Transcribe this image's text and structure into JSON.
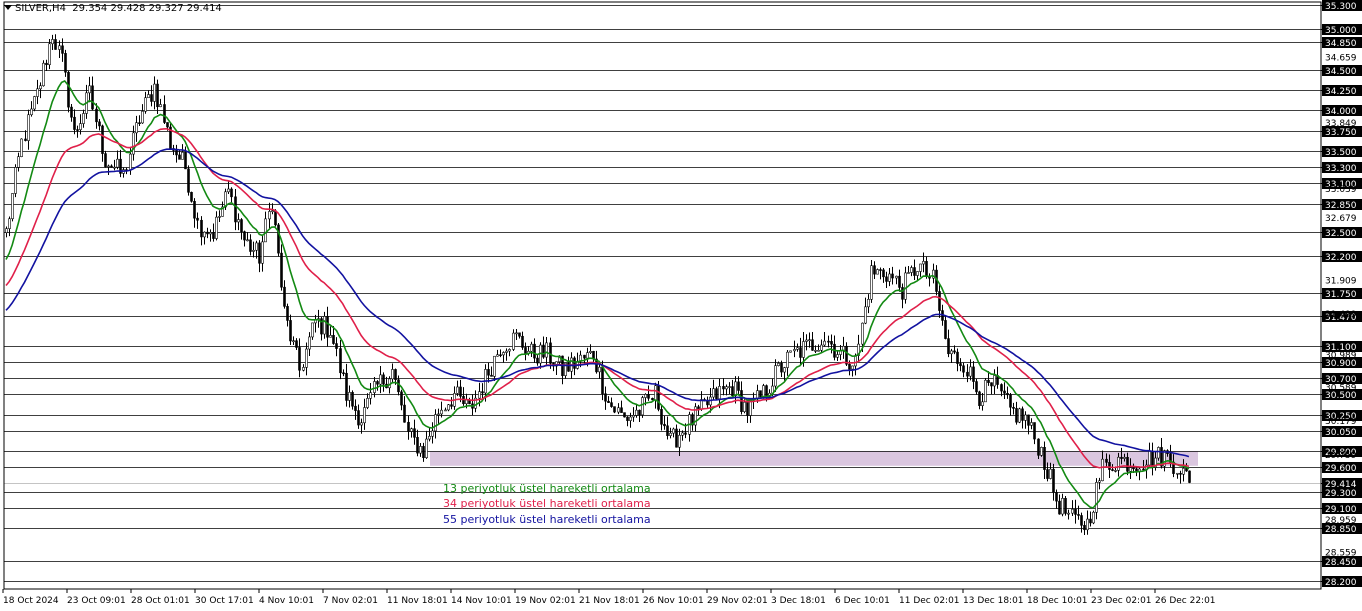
{
  "header": {
    "symbol": "SILVER,H4",
    "ohlc": "29.354 29.428 29.327 29.414"
  },
  "legend": [
    {
      "label": "13 periyotluk üstel hareketli ortalama",
      "color": "#138a13"
    },
    {
      "label": "34 periyotluk üstel hareketli ortalama",
      "color": "#e0204a"
    },
    {
      "label": "55 periyotluk üstel hareketli ortalama",
      "color": "#1212a0"
    }
  ],
  "chart_data": {
    "type": "candlestick",
    "symbol": "SILVER",
    "timeframe": "H4",
    "ylim": [
      28.1,
      35.35
    ],
    "price_labels": [
      "35.300",
      "35.000",
      "34.850",
      "34.500",
      "34.250",
      "34.000",
      "33.750",
      "33.500",
      "33.300",
      "33.100",
      "32.850",
      "32.500",
      "32.200",
      "31.750",
      "31.470",
      "31.100",
      "30.900",
      "30.700",
      "30.500",
      "30.250",
      "30.050",
      "29.800",
      "29.600",
      "29.414",
      "29.300",
      "29.100",
      "28.850",
      "28.450",
      "28.200"
    ],
    "minor_price_labels": [
      "34.659",
      "33.849",
      "33.039",
      "32.679",
      "31.909",
      "31.499",
      "30.989",
      "30.589",
      "30.179",
      "29.759",
      "28.959",
      "28.559"
    ],
    "current_price": 29.414,
    "x_labels": [
      "18 Oct 2024",
      "23 Oct 09:01",
      "28 Oct 01:01",
      "30 Oct 17:01",
      "4 Nov 10:01",
      "7 Nov 02:01",
      "11 Nov 18:01",
      "14 Nov 10:01",
      "19 Nov 02:01",
      "21 Nov 18:01",
      "26 Nov 10:01",
      "29 Nov 02:01",
      "3 Dec 18:01",
      "6 Dec 10:01",
      "11 Dec 02:01",
      "13 Dec 18:01",
      "18 Dec 10:01",
      "23 Dec 02:01",
      "26 Dec 22:01"
    ],
    "zone": {
      "from": 29.62,
      "to": 29.8,
      "color": "#d6c0dc"
    },
    "path_points": [
      [
        0,
        32.5
      ],
      [
        5,
        33.6
      ],
      [
        10,
        34.2
      ],
      [
        15,
        34.95
      ],
      [
        18,
        34.6
      ],
      [
        22,
        33.7
      ],
      [
        27,
        34.2
      ],
      [
        32,
        33.4
      ],
      [
        38,
        33.2
      ],
      [
        43,
        33.9
      ],
      [
        48,
        34.3
      ],
      [
        53,
        33.6
      ],
      [
        58,
        33.3
      ],
      [
        62,
        32.6
      ],
      [
        67,
        32.5
      ],
      [
        72,
        33.0
      ],
      [
        77,
        32.4
      ],
      [
        82,
        32.2
      ],
      [
        86,
        32.9
      ],
      [
        90,
        31.5
      ],
      [
        95,
        30.8
      ],
      [
        100,
        31.4
      ],
      [
        105,
        31.3
      ],
      [
        110,
        30.5
      ],
      [
        115,
        30.2
      ],
      [
        120,
        30.6
      ],
      [
        125,
        30.8
      ],
      [
        130,
        30.0
      ],
      [
        135,
        29.8
      ],
      [
        140,
        30.3
      ],
      [
        145,
        30.5
      ],
      [
        150,
        30.3
      ],
      [
        155,
        30.7
      ],
      [
        160,
        31.1
      ],
      [
        165,
        31.2
      ],
      [
        170,
        31.0
      ],
      [
        175,
        31.0
      ],
      [
        180,
        30.8
      ],
      [
        185,
        30.9
      ],
      [
        190,
        31.0
      ],
      [
        195,
        30.4
      ],
      [
        200,
        30.2
      ],
      [
        205,
        30.3
      ],
      [
        210,
        30.5
      ],
      [
        215,
        29.9
      ],
      [
        220,
        30.1
      ],
      [
        225,
        30.3
      ],
      [
        230,
        30.5
      ],
      [
        235,
        30.6
      ],
      [
        240,
        30.3
      ],
      [
        245,
        30.5
      ],
      [
        250,
        30.8
      ],
      [
        255,
        31.0
      ],
      [
        260,
        31.1
      ],
      [
        265,
        31.2
      ],
      [
        270,
        31.0
      ],
      [
        275,
        30.9
      ],
      [
        280,
        32.0
      ],
      [
        285,
        32.0
      ],
      [
        290,
        31.8
      ],
      [
        295,
        32.1
      ],
      [
        300,
        31.9
      ],
      [
        305,
        31.0
      ],
      [
        310,
        30.9
      ],
      [
        315,
        30.5
      ],
      [
        320,
        30.6
      ],
      [
        325,
        30.3
      ],
      [
        330,
        30.2
      ],
      [
        335,
        29.8
      ],
      [
        340,
        29.2
      ],
      [
        345,
        28.95
      ],
      [
        350,
        28.9
      ],
      [
        355,
        29.6
      ],
      [
        360,
        29.7
      ],
      [
        365,
        29.65
      ],
      [
        370,
        29.7
      ],
      [
        375,
        29.75
      ],
      [
        380,
        29.6
      ],
      [
        383,
        29.4
      ]
    ],
    "ema_periods": [
      13,
      34,
      55
    ],
    "ema_seed": {
      "13": 32.1,
      "34": 31.8,
      "55": 31.5
    },
    "bar_count": 384
  }
}
